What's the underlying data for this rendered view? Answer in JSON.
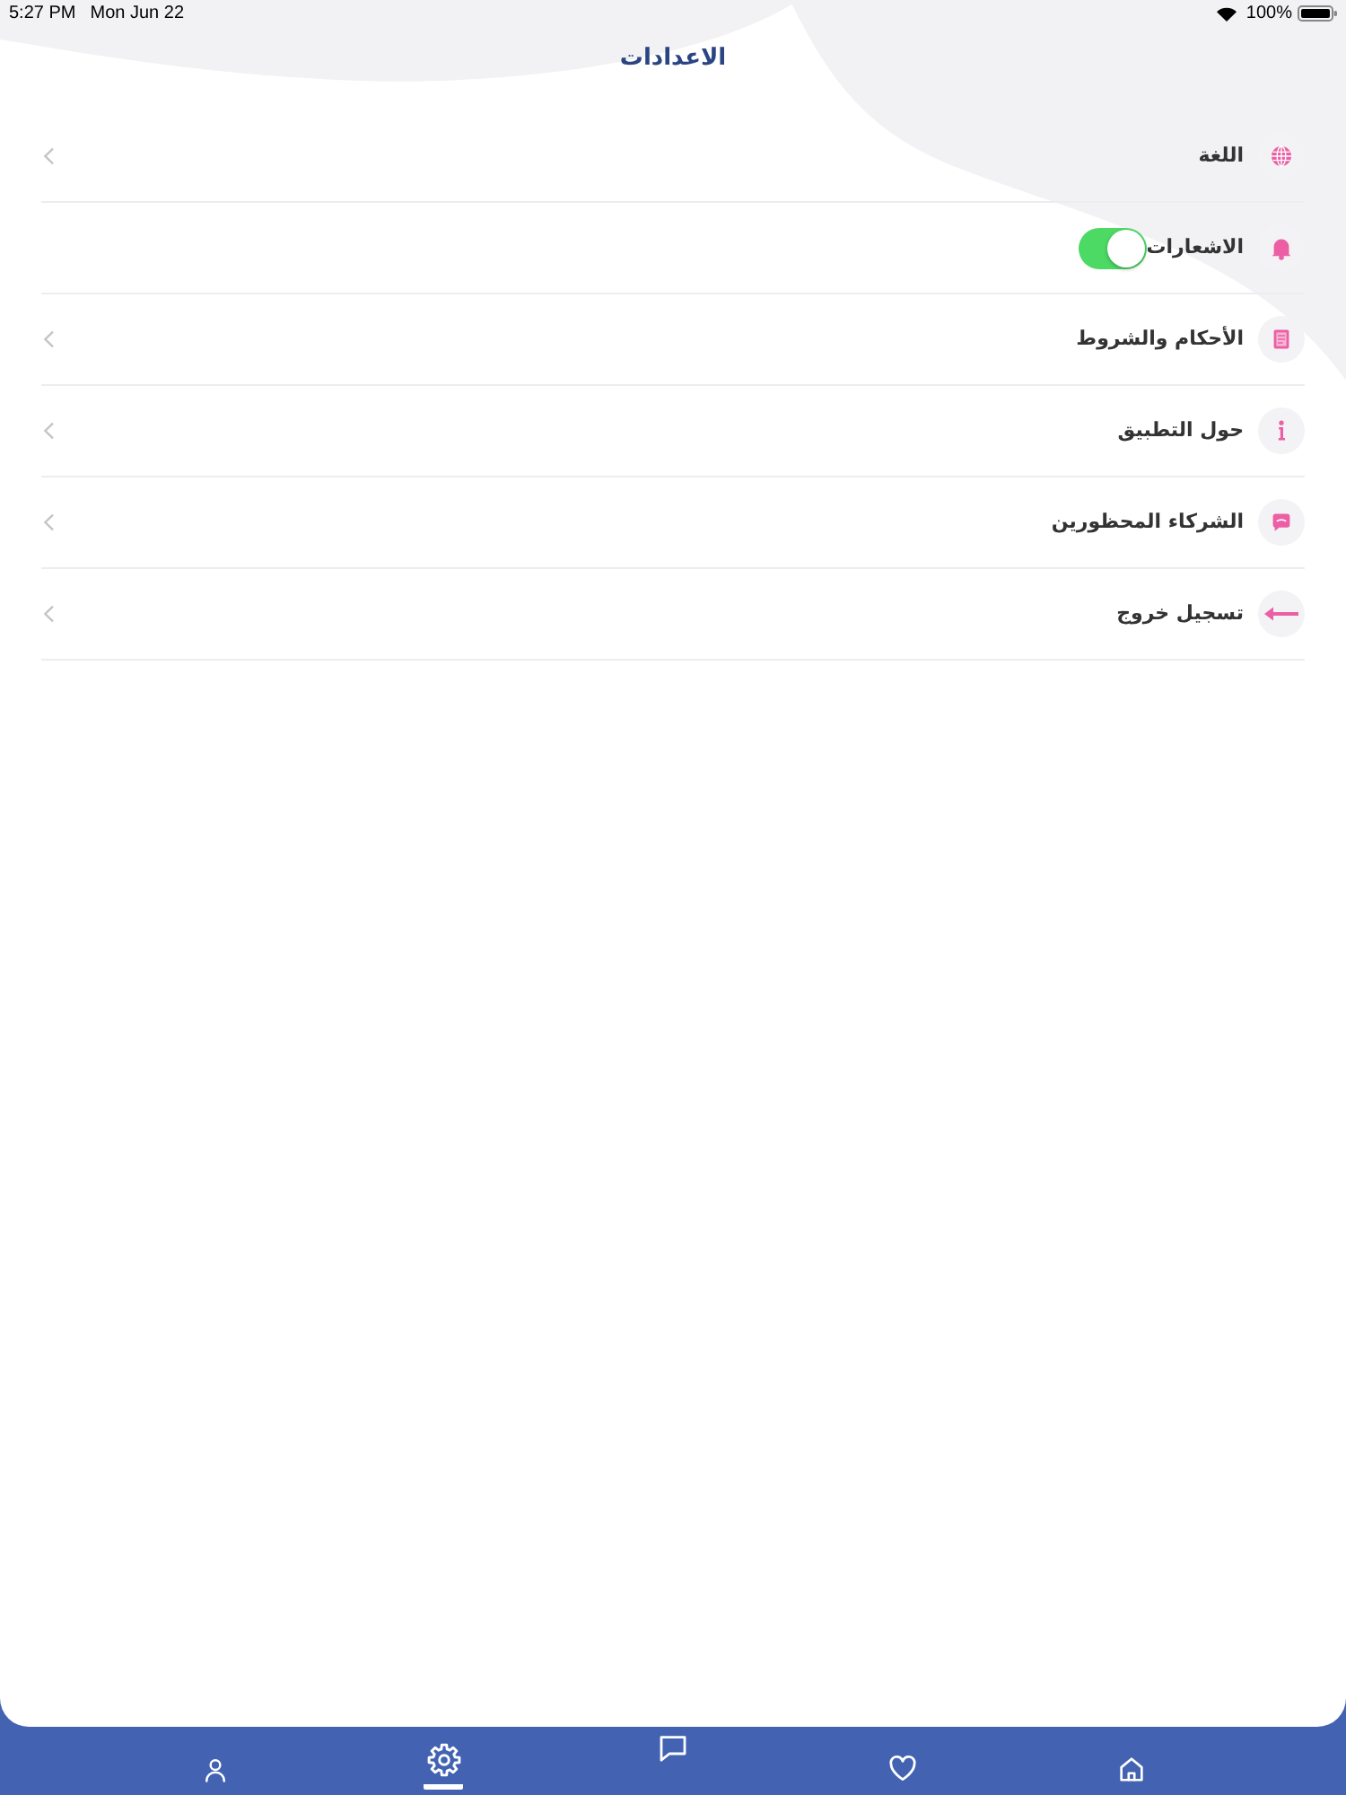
{
  "status_bar": {
    "time": "5:27 PM",
    "date": "Mon Jun 22",
    "battery": "100%"
  },
  "header": {
    "title": "الاعدادات"
  },
  "settings": [
    {
      "label": "اللغة",
      "kind": "link"
    },
    {
      "label": "الاشعارات",
      "kind": "toggle",
      "on": true
    },
    {
      "label": "الأحكام والشروط",
      "kind": "link"
    },
    {
      "label": "حول التطبيق",
      "kind": "link"
    },
    {
      "label": "الشركاء المحظورين",
      "kind": "link"
    },
    {
      "label": "تسجيل خروج",
      "kind": "link"
    }
  ],
  "tab_bar": [
    {
      "selected": false
    },
    {
      "selected": false
    },
    {
      "selected": false
    },
    {
      "selected": true
    },
    {
      "selected": false
    }
  ]
}
